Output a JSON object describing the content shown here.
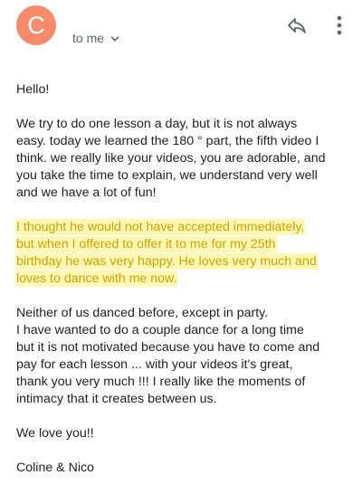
{
  "header": {
    "avatar_letter": "C",
    "avatar_color": "#f68b6b",
    "recipient_label": "to me",
    "icons": {
      "reply": "reply-icon",
      "more": "more-vert-icon",
      "expand": "chevron-down-icon"
    }
  },
  "email": {
    "greeting": "Hello!",
    "para1": [
      "We try to do one lesson a day, but it is not always",
      "easy.  today we learned the 180 ° part, the fifth video I",
      "think.  we really like your videos, you are adorable, and",
      "you take the time to explain, we understand very well",
      "and we have a lot of fun!"
    ],
    "highlighted_para": [
      "I thought he would not have accepted immediately,",
      "but when I offered to offer it to me for my 25th",
      "birthday he was very happy.  He loves very much and",
      "loves to dance with me now."
    ],
    "para3": [
      "Neither of us danced before, except in party.",
      "I have wanted to do a couple dance for a long time",
      "but it is not motivated because you have to come and",
      "pay for each lesson ... with your videos it's great,",
      "thank you very much !!!  I really like the moments of",
      "intimacy that it creates between us."
    ],
    "closing": "We love you!!",
    "signature": "Coline & Nico"
  },
  "colors": {
    "highlight_bg": "#fdf7b3",
    "highlight_text": "#c9a400"
  }
}
